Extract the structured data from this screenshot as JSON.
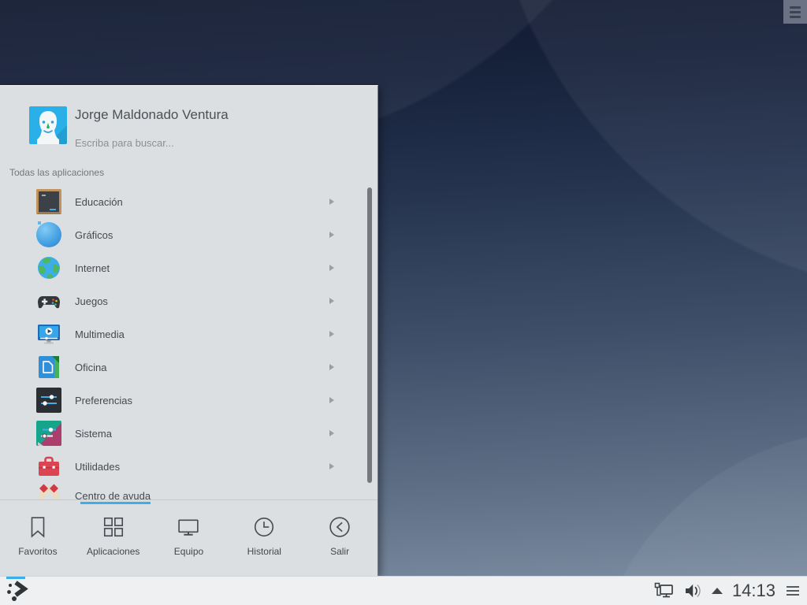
{
  "desktop": {
    "peek_button_icon": "hamburger-icon"
  },
  "menu": {
    "user_name": "Jorge Maldonado Ventura",
    "search_placeholder": "Escriba para buscar...",
    "section_label": "Todas las aplicaciones",
    "items": [
      {
        "label": "Educación",
        "icon": "education-icon"
      },
      {
        "label": "Gráficos",
        "icon": "graphics-icon"
      },
      {
        "label": "Internet",
        "icon": "internet-icon"
      },
      {
        "label": "Juegos",
        "icon": "games-icon"
      },
      {
        "label": "Multimedia",
        "icon": "multimedia-icon"
      },
      {
        "label": "Oficina",
        "icon": "office-icon"
      },
      {
        "label": "Preferencias",
        "icon": "settings-icon"
      },
      {
        "label": "Sistema",
        "icon": "system-icon"
      },
      {
        "label": "Utilidades",
        "icon": "utilities-icon"
      },
      {
        "label": "Centro de ayuda",
        "icon": "help-icon"
      }
    ],
    "tabs": [
      {
        "label": "Favoritos",
        "icon": "favorites-icon",
        "active": false
      },
      {
        "label": "Aplicaciones",
        "icon": "applications-icon",
        "active": true
      },
      {
        "label": "Equipo",
        "icon": "computer-icon",
        "active": false
      },
      {
        "label": "Historial",
        "icon": "history-icon",
        "active": false
      },
      {
        "label": "Salir",
        "icon": "leave-icon",
        "active": false
      }
    ]
  },
  "panel": {
    "launcher_icon": "kde-launcher-icon",
    "tray_icons": [
      "network-icon",
      "volume-icon",
      "expand-arrow-icon"
    ],
    "clock": "14:13",
    "overflow_icon": "hamburger-icon"
  },
  "colors": {
    "accent": "#3daee9",
    "menu_background": "#dcdfe1",
    "panel_background": "#eef0f1",
    "wallpaper_top": "#16213a",
    "wallpaper_bottom": "#8494a7"
  }
}
